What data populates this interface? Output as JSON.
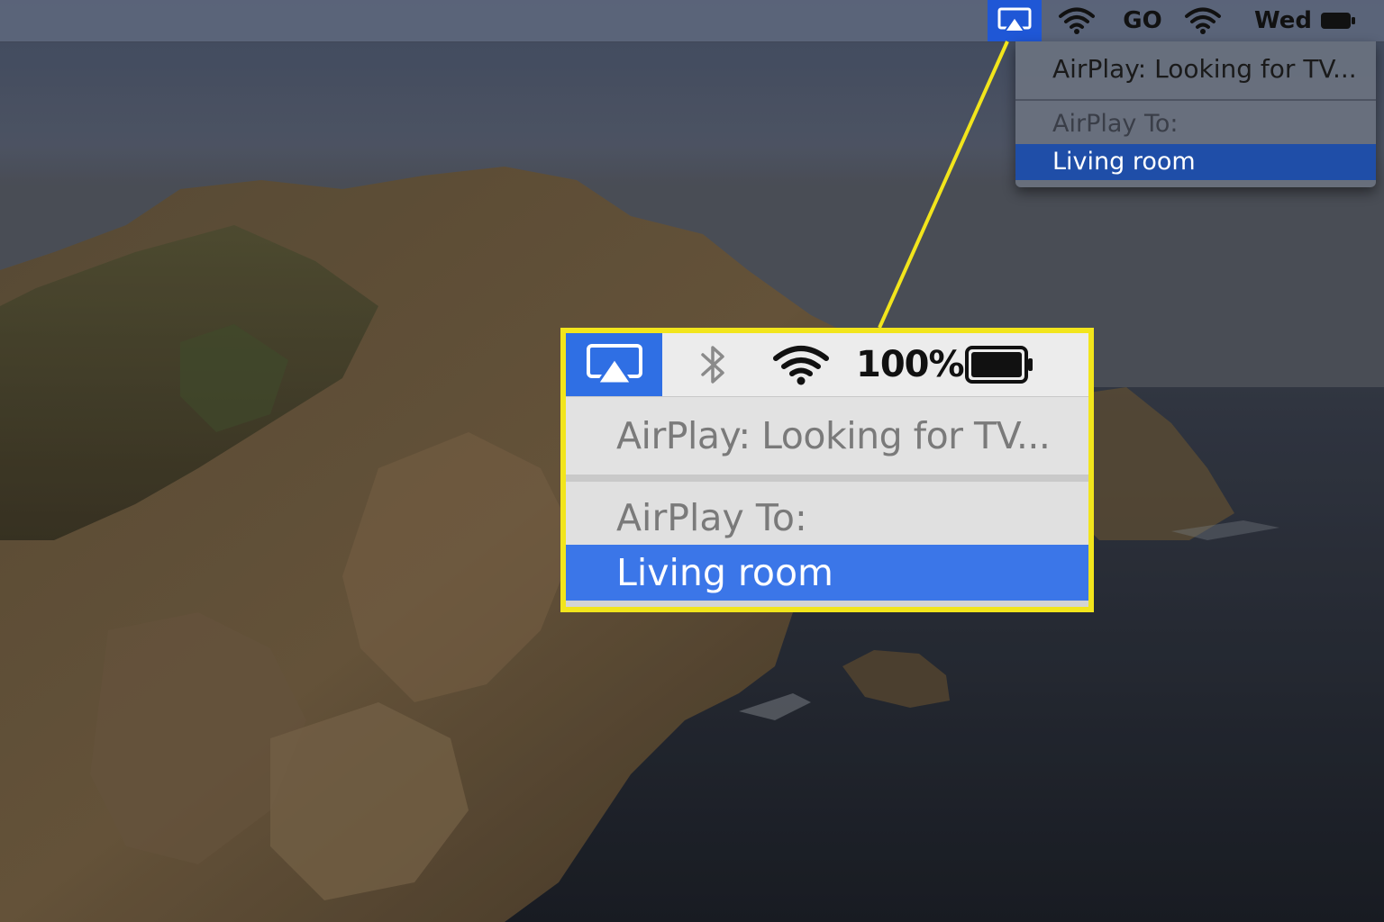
{
  "menubar": {
    "items": [
      {
        "id": "airplay",
        "icon": "airplay-icon",
        "selected": true
      },
      {
        "id": "wifi",
        "icon": "wifi-icon"
      },
      {
        "id": "go",
        "label": "GO"
      },
      {
        "id": "wifi2",
        "icon": "wifi-icon"
      },
      {
        "id": "day",
        "label": "Wed"
      },
      {
        "id": "battery",
        "icon": "battery-icon"
      }
    ]
  },
  "airplay_menu": {
    "status": "AirPlay: Looking for TV...",
    "section_header": "AirPlay To:",
    "devices": [
      {
        "label": "Living room",
        "selected": true
      }
    ]
  },
  "zoom_callout": {
    "menubar": {
      "battery_percent": "100%",
      "icons": [
        "airplay-icon",
        "bluetooth-icon",
        "wifi-icon",
        "battery-icon"
      ]
    },
    "status": "AirPlay: Looking for TV...",
    "section_header": "AirPlay To:",
    "selected_device": "Living room"
  },
  "colors": {
    "highlight_blue": "#1f57d6",
    "zoom_highlight_blue": "#3b76e8",
    "callout_yellow": "#f2e51c"
  }
}
